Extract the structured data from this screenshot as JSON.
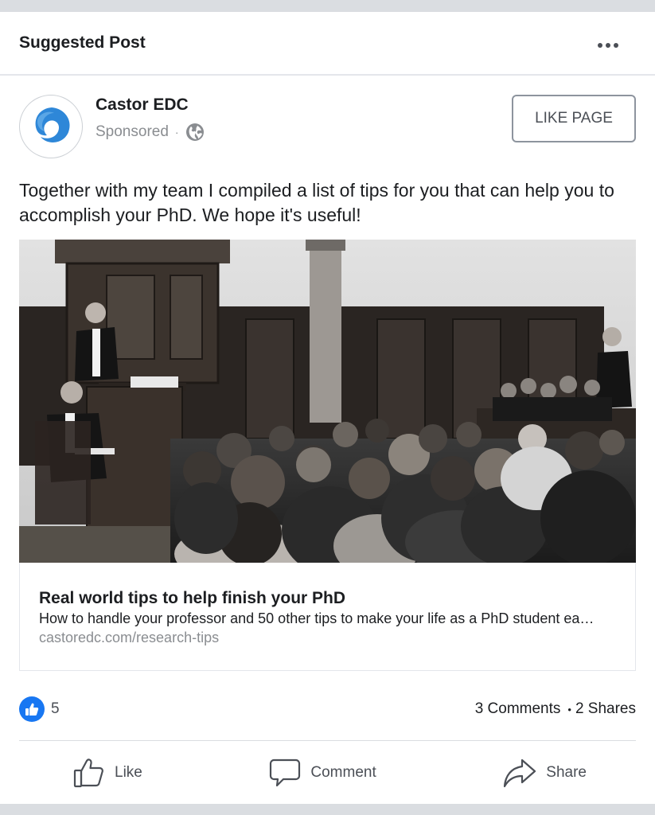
{
  "header": {
    "title": "Suggested Post"
  },
  "page": {
    "name": "Castor EDC",
    "sponsored_label": "Sponsored",
    "separator": "·",
    "like_page_label": "LIKE PAGE"
  },
  "post": {
    "text": "Together with my team I compiled a list of tips for you that can help you to accomplish your PhD.  We hope it's useful!"
  },
  "link": {
    "title": "Real world tips to help finish your PhD",
    "description": "How to handle your professor and 50 other tips to make your life as a PhD student ea…",
    "url": "castoredc.com/research-tips"
  },
  "stats": {
    "reactions": "5",
    "comments": "3 Comments",
    "bullet": "•",
    "shares": "2 Shares"
  },
  "actions": {
    "like": "Like",
    "comment": "Comment",
    "share": "Share"
  },
  "colors": {
    "brand_blue": "#1877f2",
    "logo_blue": "#2e87d8",
    "text": "#1c1e21",
    "muted": "#8a8d91"
  },
  "icons": [
    "more-icon",
    "castor-logo-icon",
    "globe-icon",
    "thumbs-up-icon",
    "comment-icon",
    "share-icon"
  ]
}
